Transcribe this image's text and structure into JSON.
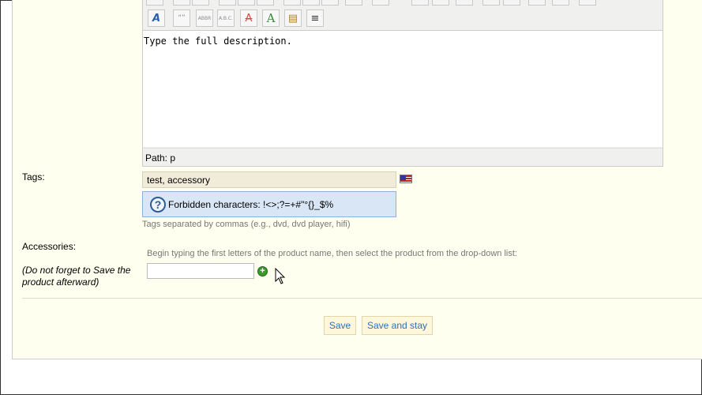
{
  "editor": {
    "content": "Type the full description.",
    "path_label": "Path: p",
    "toolbar_row2": [
      {
        "name": "font-color-icon",
        "glyph": "A"
      },
      {
        "name": "blockquote-icon",
        "glyph": "“”"
      },
      {
        "name": "abbr-icon",
        "glyph": "ABBR"
      },
      {
        "name": "acronym-icon",
        "glyph": "A.B.C."
      },
      {
        "name": "strikethrough-icon",
        "glyph": "A"
      },
      {
        "name": "text-color-icon",
        "glyph": "A"
      },
      {
        "name": "attributes-icon",
        "glyph": "▤"
      },
      {
        "name": "insert-hr-icon",
        "glyph": "≡"
      }
    ]
  },
  "tags": {
    "label": "Tags:",
    "value": "test, accessory",
    "forbidden_text": "Forbidden characters: !<>;?=+#\"°{}_$%",
    "help_text": "Tags separated by commas (e.g., dvd, dvd player, hifi)"
  },
  "accessories": {
    "label": "Accessories:",
    "note": "(Do not forget to Save the product afterward)",
    "instruction": "Begin typing the first letters of the product name, then select the product from the drop-down list:",
    "input_value": ""
  },
  "buttons": {
    "save": "Save",
    "save_and_stay": "Save and stay"
  }
}
